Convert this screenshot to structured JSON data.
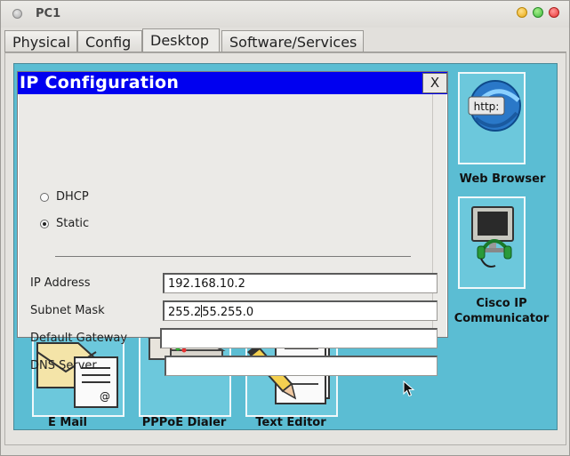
{
  "window": {
    "title": "PC1"
  },
  "tabs": [
    {
      "label": "Physical",
      "active": false
    },
    {
      "label": "Config",
      "active": false
    },
    {
      "label": "Desktop",
      "active": true
    },
    {
      "label": "Software/Services",
      "active": false
    }
  ],
  "dialog": {
    "title": "IP Configuration",
    "close_label": "X",
    "mode_options": [
      {
        "label": "DHCP",
        "checked": false
      },
      {
        "label": "Static",
        "checked": true
      }
    ],
    "fields": [
      {
        "label": "IP Address",
        "value": "192.168.10.2"
      },
      {
        "label": "Subnet Mask",
        "value_before_caret": "255.2",
        "value_after_caret": "55.255.0"
      },
      {
        "label": "Default Gateway",
        "value": ""
      },
      {
        "label": "DNS Server",
        "value": ""
      }
    ]
  },
  "desktop_apps": {
    "web_browser": {
      "label": "Web Browser",
      "icon_text": "http:"
    },
    "cisco_ip_communicator": {
      "label_line1": "Cisco IP",
      "label_line2": "Communicator"
    },
    "email": {
      "label": "E Mail"
    },
    "pppoe_dialer": {
      "label": "PPPoE Dialer"
    },
    "text_editor": {
      "label": "Text Editor"
    }
  },
  "colors": {
    "desktop_bg": "#5bbdd3",
    "dialog_header": "#0000f0"
  }
}
